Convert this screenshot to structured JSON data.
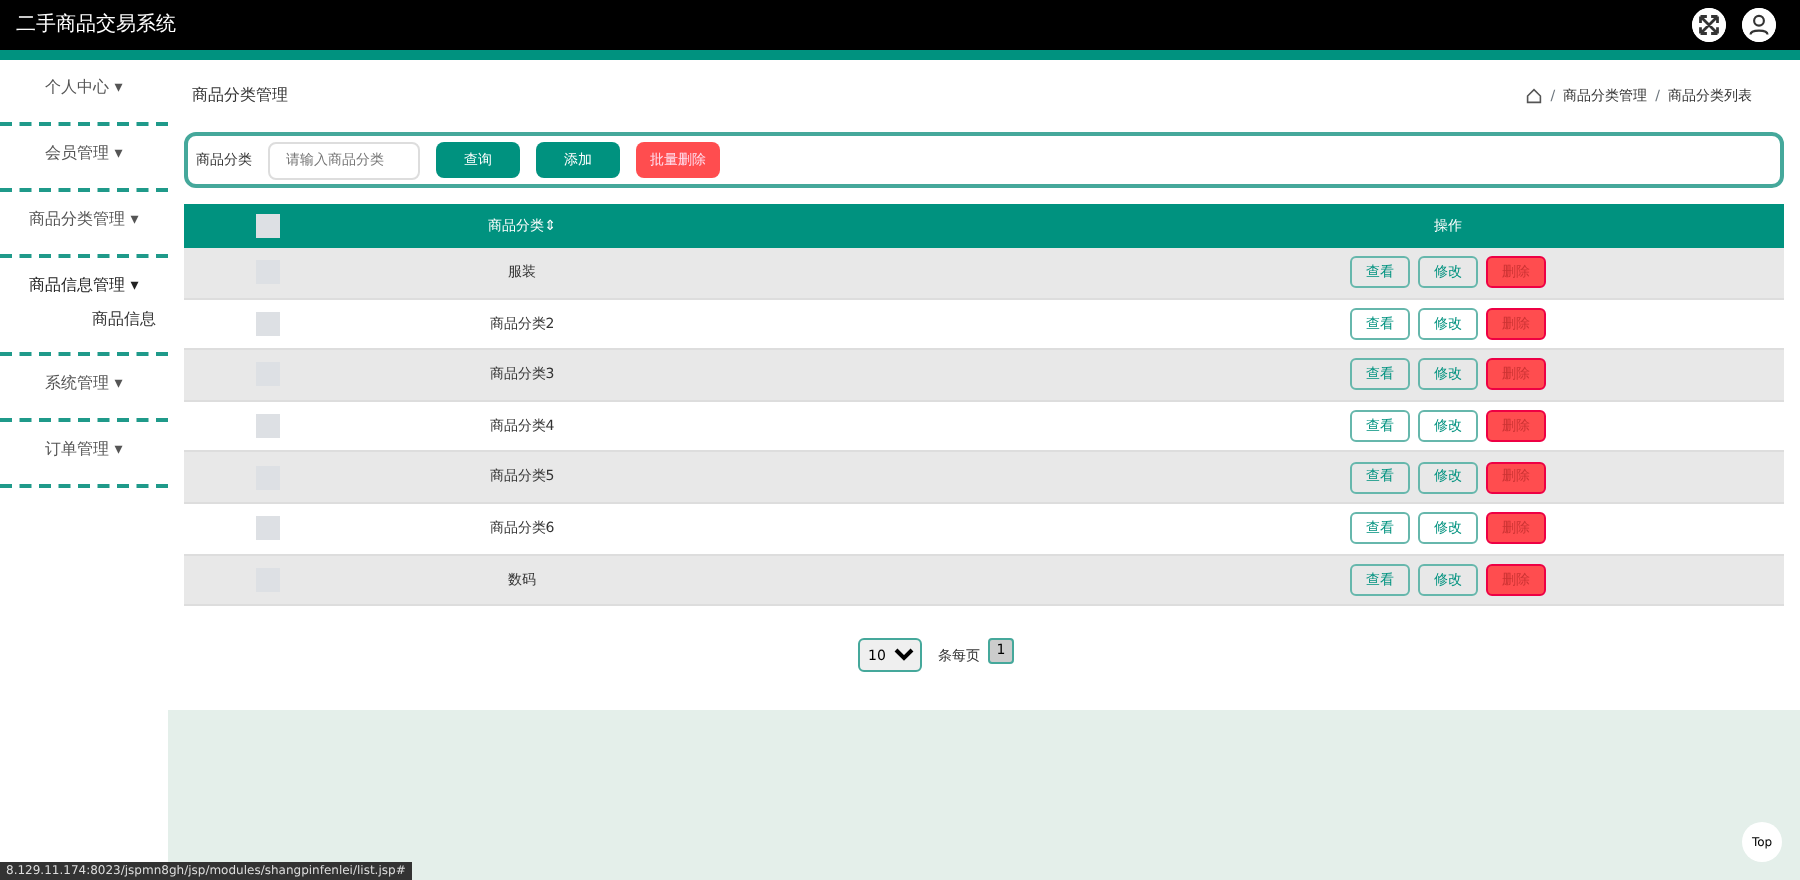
{
  "window": {
    "title": "二手商品交易系统"
  },
  "breadcrumb_separator": "/",
  "sidebar": {
    "items": [
      {
        "label": "个人中心",
        "caret": "▾",
        "expanded": false
      },
      {
        "label": "会员管理",
        "caret": "▾",
        "expanded": false
      },
      {
        "label": "商品分类管理",
        "caret": "▾",
        "expanded": false
      },
      {
        "label": "商品信息管理",
        "caret": "▾",
        "expanded": true,
        "children": [
          {
            "label": "商品信息"
          }
        ]
      },
      {
        "label": "系统管理",
        "caret": "▾",
        "expanded": false
      },
      {
        "label": "订单管理",
        "caret": "▾",
        "expanded": false
      }
    ]
  },
  "page_title": "商品分类管理",
  "breadcrumb": [
    "商品分类管理",
    "商品分类列表"
  ],
  "search": {
    "label": "商品分类",
    "placeholder": "请输入商品分类",
    "buttons": [
      {
        "label": "查询",
        "kind": "primary"
      },
      {
        "label": "添加",
        "kind": "primary"
      },
      {
        "label": "批量删除",
        "kind": "danger"
      }
    ]
  },
  "table": {
    "columns": [
      "商品分类⇕",
      "操作"
    ],
    "header_checked": false,
    "rows": [
      {
        "name": "服装",
        "checked": false,
        "actions": [
          "查看",
          "修改",
          "删除"
        ]
      },
      {
        "name": "商品分类2",
        "checked": false,
        "actions": [
          "查看",
          "修改",
          "删除"
        ]
      },
      {
        "name": "商品分类3",
        "checked": false,
        "actions": [
          "查看",
          "修改",
          "删除"
        ]
      },
      {
        "name": "商品分类4",
        "checked": false,
        "actions": [
          "查看",
          "修改",
          "删除"
        ]
      },
      {
        "name": "商品分类5",
        "checked": false,
        "actions": [
          "查看",
          "修改",
          "删除"
        ]
      },
      {
        "name": "商品分类6",
        "checked": false,
        "actions": [
          "查看",
          "修改",
          "删除"
        ]
      },
      {
        "name": "数码",
        "checked": false,
        "actions": [
          "查看",
          "修改",
          "删除"
        ]
      }
    ]
  },
  "pagination": {
    "page_size": "10",
    "per_page_label": "条每页",
    "pages": [
      {
        "label": "1",
        "selected": true
      }
    ]
  },
  "top_button": "Top",
  "status_bar": "8.129.11.174:8023/jspmn8gh/jsp/modules/shangpinfenlei/list.jsp#"
}
